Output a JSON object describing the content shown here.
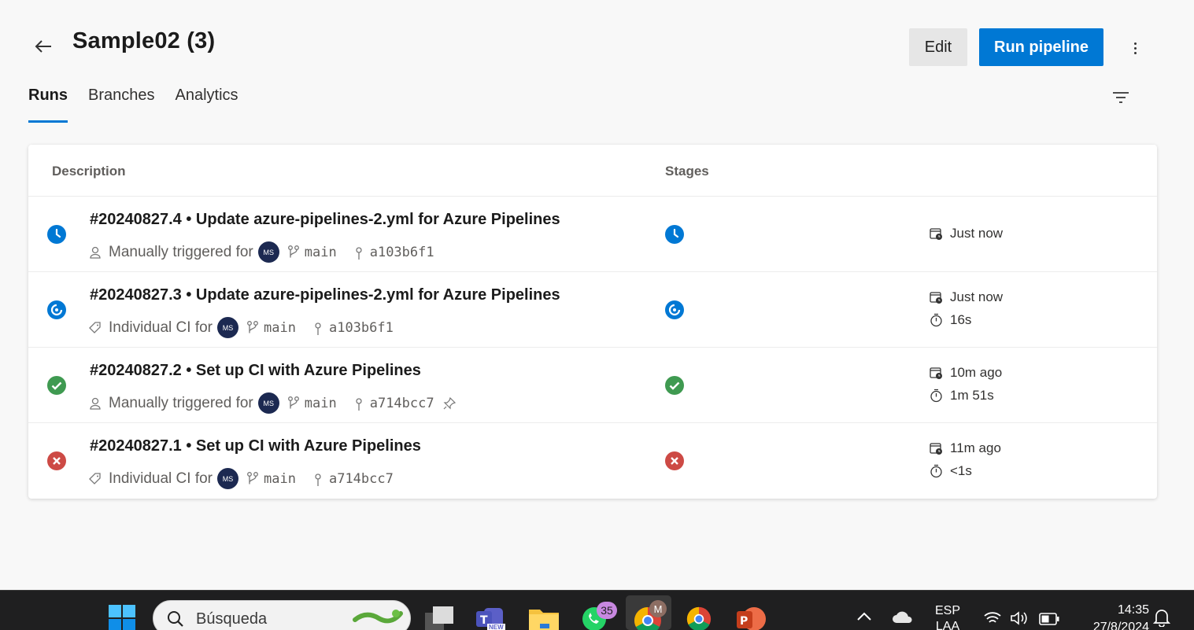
{
  "header": {
    "title": "Sample02 (3)",
    "edit_label": "Edit",
    "run_label": "Run pipeline"
  },
  "tabs": [
    {
      "label": "Runs",
      "active": true
    },
    {
      "label": "Branches",
      "active": false
    },
    {
      "label": "Analytics",
      "active": false
    }
  ],
  "table": {
    "col_description": "Description",
    "col_stages": "Stages",
    "rows": [
      {
        "title": "#20240827.4 • Update azure-pipelines-2.yml for Azure Pipelines",
        "status": "queued",
        "trigger": "Manually triggered for",
        "avatar": "MS",
        "branch": "main",
        "commit": "a103b6f1",
        "started": "Just now",
        "duration": ""
      },
      {
        "title": "#20240827.3 • Update azure-pipelines-2.yml for Azure Pipelines",
        "status": "running",
        "trigger": "Individual CI for",
        "avatar": "MS",
        "branch": "main",
        "commit": "a103b6f1",
        "started": "Just now",
        "duration": "16s"
      },
      {
        "title": "#20240827.2 • Set up CI with Azure Pipelines",
        "status": "succeeded",
        "trigger": "Manually triggered for",
        "avatar": "MS",
        "branch": "main",
        "commit": "a714bcc7",
        "started": "10m ago",
        "duration": "1m 51s"
      },
      {
        "title": "#20240827.1 • Set up CI with Azure Pipelines",
        "status": "failed",
        "trigger": "Individual CI for",
        "avatar": "MS",
        "branch": "main",
        "commit": "a714bcc7",
        "started": "11m ago",
        "duration": "<1s"
      }
    ]
  },
  "taskbar": {
    "search_placeholder": "Búsqueda",
    "whatsapp_badge": "35",
    "chrome_profile": "M",
    "teams_badge": "NEW",
    "lang_top": "ESP",
    "lang_bottom": "LAA",
    "time": "14:35",
    "date": "27/8/2024"
  },
  "colors": {
    "accent": "#0078d4",
    "success": "#3f9a51",
    "failed": "#cd4a45"
  }
}
